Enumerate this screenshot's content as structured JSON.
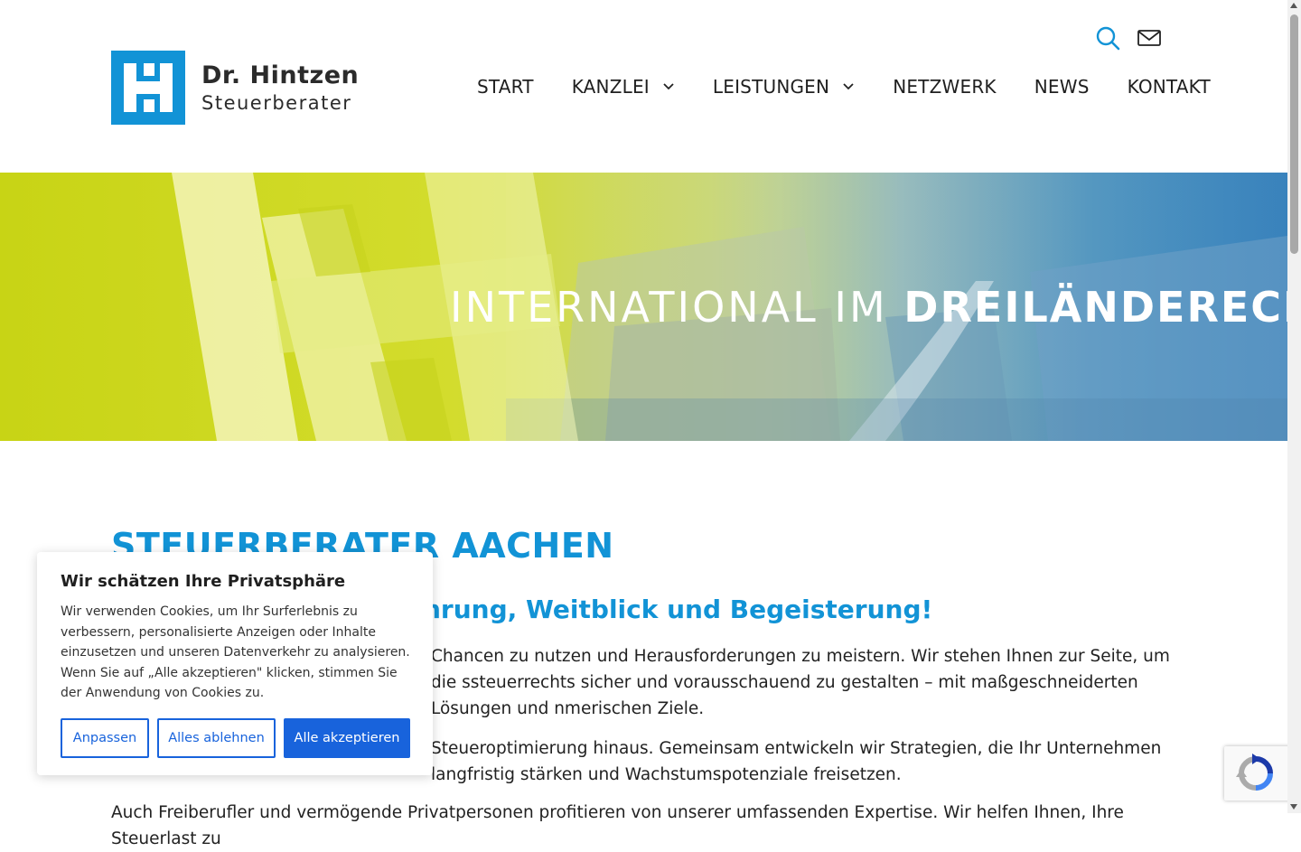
{
  "brand": {
    "name": "Dr. Hintzen",
    "subtitle": "Steuerberater",
    "accent_color": "#1293d6",
    "hero_green": "#c8d415"
  },
  "header": {
    "icons": [
      "search-icon",
      "mail-icon"
    ],
    "nav": [
      {
        "label": "START",
        "has_dropdown": false
      },
      {
        "label": "KANZLEI",
        "has_dropdown": true
      },
      {
        "label": "LEISTUNGEN",
        "has_dropdown": true
      },
      {
        "label": "NETZWERK",
        "has_dropdown": false
      },
      {
        "label": "NEWS",
        "has_dropdown": false
      },
      {
        "label": "KONTAKT",
        "has_dropdown": false
      }
    ]
  },
  "hero": {
    "title_light": "INTERNATIONAL IM ",
    "title_bold": "DREILÄNDERECK"
  },
  "main": {
    "heading": "STEUERBERATER AACHEN",
    "subheading": "nrung, Weitblick und Begeisterung!",
    "paragraphs": [
      "Chancen zu nutzen und Herausforderungen zu meistern. Wir stehen Ihnen zur Seite, um die ssteuerrechts sicher und vorausschauend zu gestalten – mit maßgeschneiderten Lösungen und nmerischen Ziele.",
      "Steueroptimierung hinaus. Gemeinsam entwickeln wir Strategien, die Ihr Unternehmen langfristig stärken und Wachstumspotenziale freisetzen.",
      "Auch Freiberufler und vermögende Privatpersonen profitieren von unserer umfassenden Expertise. Wir helfen Ihnen, Ihre Steuerlast zu"
    ]
  },
  "cookie": {
    "title": "Wir schätzen Ihre Privatsphäre",
    "text": "Wir verwenden Cookies, um Ihr Surferlebnis zu verbessern, personalisierte Anzeigen oder Inhalte einzusetzen und unseren Datenverkehr zu analysieren. Wenn Sie auf „Alle akzeptieren\" klicken, stimmen Sie der Anwendung von Cookies zu.",
    "customize_label": "Anpassen",
    "reject_label": "Alles ablehnen",
    "accept_label": "Alle akzeptieren",
    "button_color": "#1863dc"
  },
  "recaptcha": {
    "icon": "recaptcha-icon"
  }
}
